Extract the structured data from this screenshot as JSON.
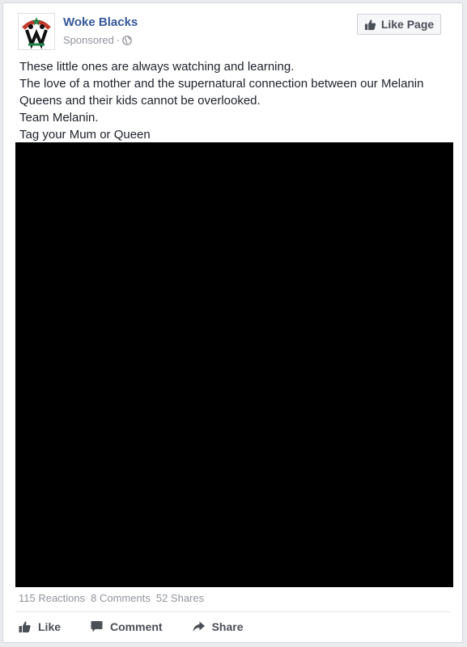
{
  "post": {
    "page_name": "Woke Blacks",
    "sponsored_label": "Sponsored",
    "separator": "·",
    "audience_icon": "globe-icon",
    "like_page_label": "Like Page",
    "text_lines": [
      "These little ones are always watching and learning.",
      "The love of a mother and the supernatural connection between our Melanin",
      "Queens and their kids cannot be overlooked.",
      "Team Melanin.",
      "Tag your Mum or Queen"
    ],
    "media_color": "#000000",
    "counts": {
      "reactions": "115 Reactions",
      "comments": "8 Comments",
      "shares": "52 Shares"
    },
    "actions": {
      "like": "Like",
      "comment": "Comment",
      "share": "Share"
    }
  },
  "colors": {
    "link_blue": "#365899",
    "muted_gray": "#90949c",
    "text": "#1d2129",
    "button_text": "#4b4f56"
  }
}
